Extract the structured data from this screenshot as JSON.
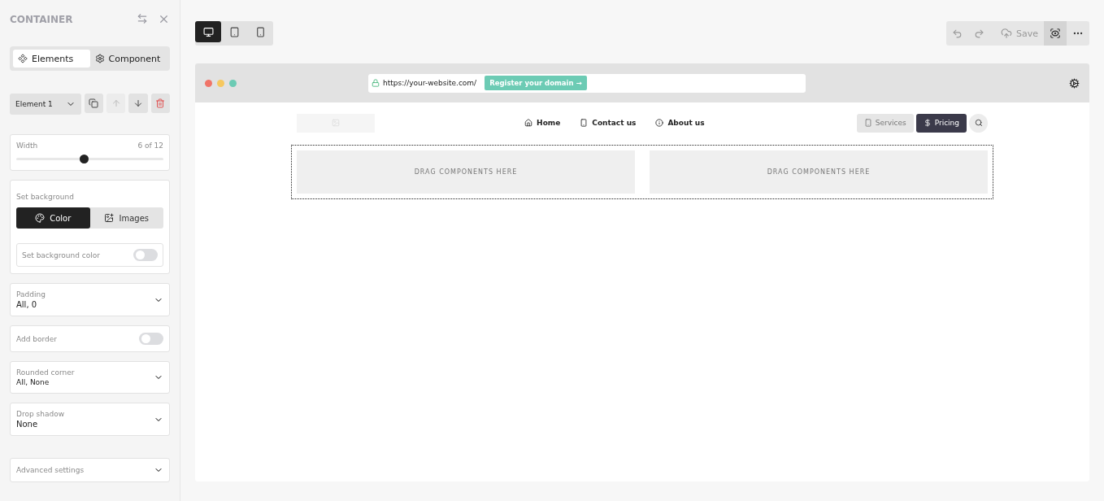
{
  "panel": {
    "title": "CONTAINER",
    "tabs": [
      {
        "label": "Elements",
        "kind": "elements",
        "selected": true
      },
      {
        "label": "Component",
        "kind": "component",
        "selected": false
      }
    ],
    "element_select": {
      "value": "Element 1"
    },
    "element_actions": [
      {
        "kind": "copy",
        "disabled": false
      },
      {
        "kind": "up",
        "disabled": true
      },
      {
        "kind": "down",
        "disabled": false
      },
      {
        "kind": "delete",
        "disabled": false
      }
    ],
    "width": {
      "label": "Width",
      "reading": "6 of 12",
      "level": 0.46
    },
    "background": {
      "label": "Set background",
      "options": [
        {
          "label": "Color",
          "kind": "color",
          "selected": true
        },
        {
          "label": "Images",
          "kind": "images",
          "selected": false
        }
      ],
      "toggle": {
        "label": "Set background color",
        "on": false
      }
    },
    "padding": {
      "label": "Padding",
      "value": "All, 0"
    },
    "border": {
      "label": "Add border",
      "on": false
    },
    "rounded_corner": {
      "label": "Rounded corner",
      "value": "All, None"
    },
    "drop_shadow": {
      "label": "Drop shadow",
      "value": "None"
    },
    "advanced": {
      "label": "Advanced settings"
    }
  },
  "devices": [
    {
      "kind": "desktop",
      "selected": true
    },
    {
      "kind": "tablet",
      "selected": false
    },
    {
      "kind": "mobile",
      "selected": false
    }
  ],
  "toolbar": {
    "save": "Save",
    "preview_selected": true
  },
  "browser": {
    "url": "https://your-website.com/",
    "register": "Register your domain →",
    "nav_links": [
      {
        "label": "Home",
        "kind": "home"
      },
      {
        "label": "Contact us",
        "kind": "phone"
      },
      {
        "label": "About us",
        "kind": "info"
      }
    ],
    "nav_buttons": [
      {
        "label": "Services",
        "kind": "phone",
        "selected": false
      },
      {
        "label": "Pricing",
        "kind": "dollar",
        "selected": true
      }
    ],
    "drop_zones": [
      "DRAG COMPONENTS HERE",
      "DRAG COMPONENTS HERE"
    ]
  }
}
